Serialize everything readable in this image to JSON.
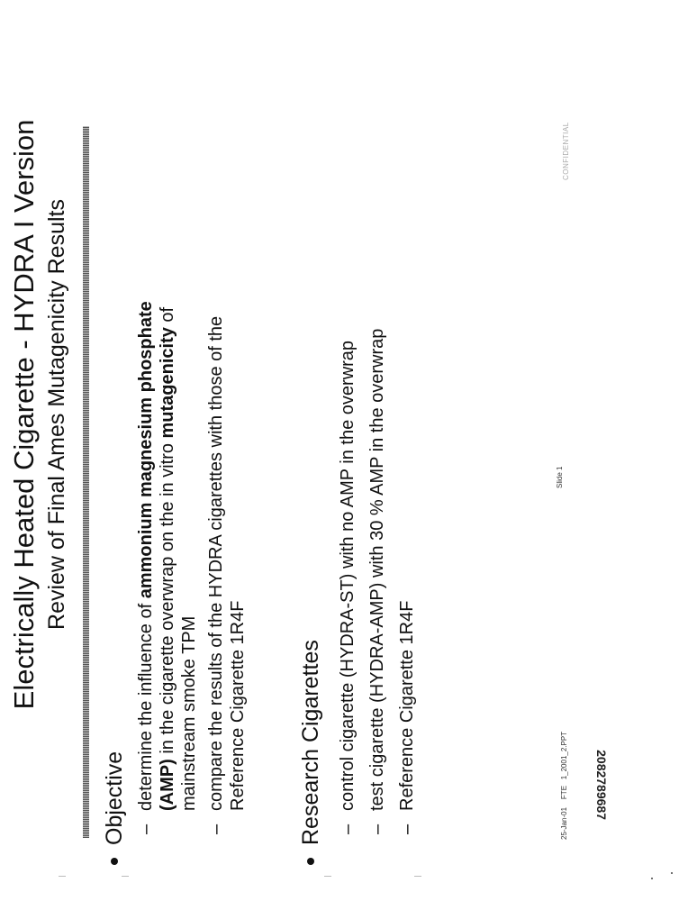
{
  "slide": {
    "title": "Electrically Heated Cigarette - HYDRA I Version",
    "subtitle": "Review of Final Ames Mutagenicity Results",
    "sections": [
      {
        "heading": "Objective",
        "items": [
          {
            "t1": "determine the influence of ",
            "b1": "ammonium magnesium phosphate",
            "b2": "(AMP)",
            "t2": " in the cigarette overwrap on the in vitro ",
            "b3": "mutagenicity",
            "t3": " of",
            "line3": "mainstream smoke TPM"
          },
          {
            "line1": "compare the results of the HYDRA cigarettes with those of the",
            "line2": "Reference Cigarette 1R4F"
          }
        ]
      },
      {
        "heading": "Research Cigarettes",
        "items": [
          "control cigarette (HYDRA-ST) with no AMP in the overwrap",
          "test cigarette (HYDRA-AMP) with 30 % AMP in the overwrap",
          "Reference Cigarette 1R4F"
        ]
      }
    ],
    "dash": "–",
    "footer": {
      "date": "25-Jan-01",
      "code": "FTE",
      "file": "1_2001_2.PPT",
      "slide_label": "Slide 1",
      "confidential": "CONFIDENTIAL"
    },
    "bates": "2082789687"
  }
}
